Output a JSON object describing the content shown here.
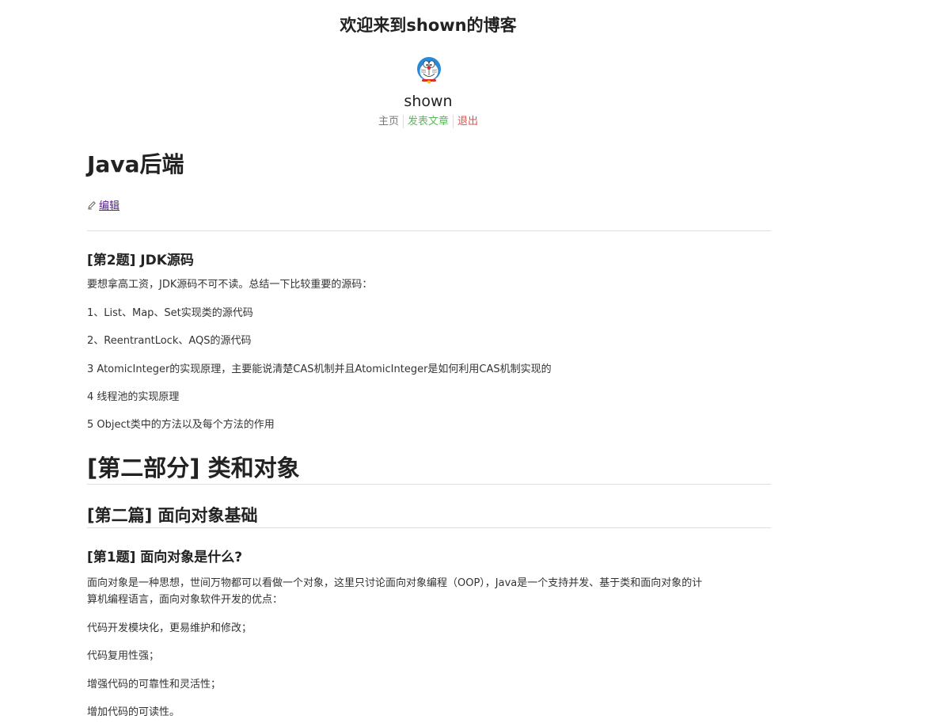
{
  "site": {
    "title": "欢迎来到shown的博客",
    "username": "shown"
  },
  "nav": {
    "home": "主页",
    "publish": "发表文章",
    "logout": "退出"
  },
  "post": {
    "title": "Java后端",
    "edit_label": "编辑"
  },
  "sections": {
    "q2_heading": "[第2题] JDK源码",
    "q2_intro": "要想拿高工资，JDK源码不可不读。总结一下比较重要的源码：",
    "q2_item1": "1、List、Map、Set实现类的源代码",
    "q2_item2": "2、ReentrantLock、AQS的源代码",
    "q2_item3": "3 AtomicInteger的实现原理，主要能说清楚CAS机制并且AtomicInteger是如何利用CAS机制实现的",
    "q2_item4": "4 线程池的实现原理",
    "q2_item5": "5 Object类中的方法以及每个方法的作用",
    "part2_heading": "[第二部分] 类和对象",
    "chapter2_heading": "[第二篇] 面向对象基础",
    "q1_heading": "[第1题] 面向对象是什么?",
    "q1_line1": "面向对象是一种思想，世间万物都可以看做一个对象，这里只讨论面向对象编程（OOP），Java是一个支持并发、基于类和面向对象的计",
    "q1_line2": "算机编程语言，面向对象软件开发的优点：",
    "q1_item1": "代码开发模块化，更易维护和修改；",
    "q1_item2": "代码复用性强；",
    "q1_item3": "增强代码的可靠性和灵活性；",
    "q1_item4": "增加代码的可读性。"
  },
  "colors": {
    "nav_home": "#777777",
    "nav_publish": "#5cb85c",
    "nav_logout": "#d9534f",
    "link_visited": "#551a8b"
  },
  "icons": {
    "avatar": "doraemon-avatar",
    "edit": "pencil-icon"
  }
}
